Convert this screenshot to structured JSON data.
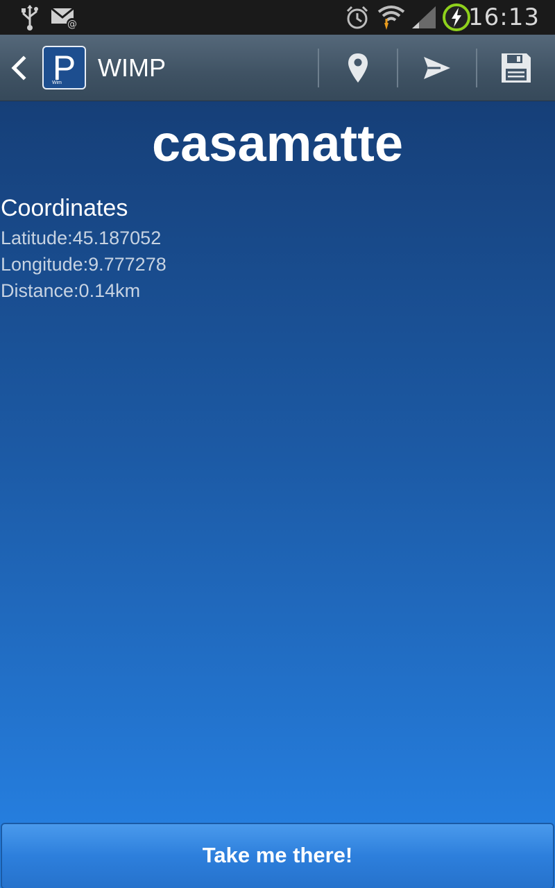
{
  "status_bar": {
    "time": "16:13",
    "icons": [
      "usb-icon",
      "email-icon",
      "alarm-icon",
      "wifi-icon",
      "signal-icon",
      "battery-charging-icon"
    ]
  },
  "action_bar": {
    "logo_letter": "P",
    "logo_small_text": "Wim",
    "title": "WIMP",
    "actions": [
      "location-pin-icon",
      "send-icon",
      "save-icon"
    ]
  },
  "place": {
    "name": "casamatte",
    "coordinates_heading": "Coordinates",
    "latitude": "Latitude:45.187052",
    "longitude": "Longitude:9.777278",
    "distance": "Distance:0.14km"
  },
  "button": {
    "label": "Take me there!"
  },
  "colors": {
    "status_bar": "#1a1a1a",
    "action_bar": "#485b6c",
    "background_top": "#163f78",
    "background_bottom": "#2784e8",
    "battery_ring": "#8fd11c"
  }
}
